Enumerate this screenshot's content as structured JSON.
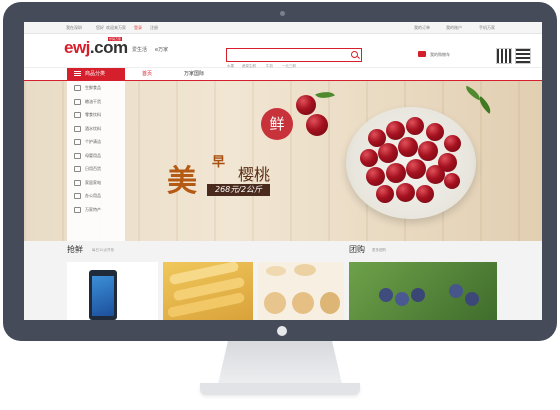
{
  "topbar": {
    "location": "我在深圳",
    "greeting": "您好",
    "welcome": "欢迎来万家",
    "login": "登录",
    "register": "注册",
    "my_orders": "我的订单",
    "my_account": "我的账户",
    "mobile": "手机万家"
  },
  "header": {
    "logo_main": "ewj",
    "logo_suffix": ".com",
    "logo_badge": "华润万家",
    "tagline_1": "爱生活",
    "tagline_2": "e万家",
    "search_placeholder": "",
    "hot_words": [
      "水果",
      "蔬菜生鲜",
      "牛奶",
      "一元三鲜"
    ],
    "cart_label": "我的购物车"
  },
  "nav": {
    "category_label": "商品分类",
    "links": [
      "首页",
      "万家国际"
    ]
  },
  "sidebar": {
    "items": [
      "生鲜食品",
      "粮油干货",
      "零食饮料",
      "酒水饮料",
      "个护清洁",
      "母婴用品",
      "日用百货",
      "家居家电",
      "办公用品",
      "万家特产"
    ]
  },
  "banner": {
    "badge": "鲜",
    "slogan_big": "美",
    "slogan_small": "早",
    "title": "樱桃",
    "price": "268元/2公斤"
  },
  "sections": {
    "left_title": "抢鲜",
    "left_sub": "每日10点开抢",
    "right_title": "团购",
    "right_sub": "更多团购"
  },
  "colors": {
    "brand": "#d61f2c",
    "monitor_frame": "#454b58"
  }
}
